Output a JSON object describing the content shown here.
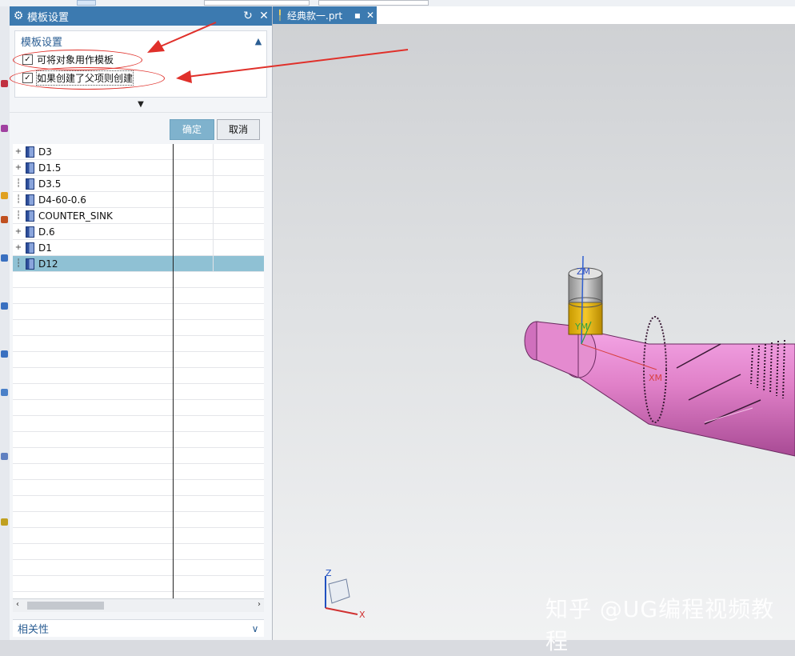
{
  "dialog": {
    "title": "模板设置",
    "section_title": "模板设置",
    "checkboxes": [
      {
        "label": "可将对象用作模板",
        "checked": true
      },
      {
        "label": "如果创建了父项则创建",
        "checked": true
      }
    ],
    "ok_label": "确定",
    "cancel_label": "取消"
  },
  "tree": {
    "rows": [
      {
        "name": "D3",
        "expandable": true
      },
      {
        "name": "D1.5",
        "expandable": true
      },
      {
        "name": "D3.5",
        "expandable": false
      },
      {
        "name": "D4-60-0.6",
        "expandable": false
      },
      {
        "name": "COUNTER_SINK",
        "expandable": false
      },
      {
        "name": "D.6",
        "expandable": true
      },
      {
        "name": "D1",
        "expandable": true
      },
      {
        "name": "D12",
        "expandable": false,
        "selected": true
      }
    ]
  },
  "relations_section": {
    "title": "相关性"
  },
  "tab": {
    "name": "经典款一.prt"
  },
  "viewport": {
    "csys_labels": [
      "ZM",
      "YM",
      "XM"
    ],
    "triad_labels": [
      "Z",
      "X"
    ]
  },
  "watermark": "知乎 @UG编程视频教程",
  "colors": {
    "accent": "#3c7ab0",
    "part": "#e080c8",
    "highlight": "#e0302a"
  }
}
